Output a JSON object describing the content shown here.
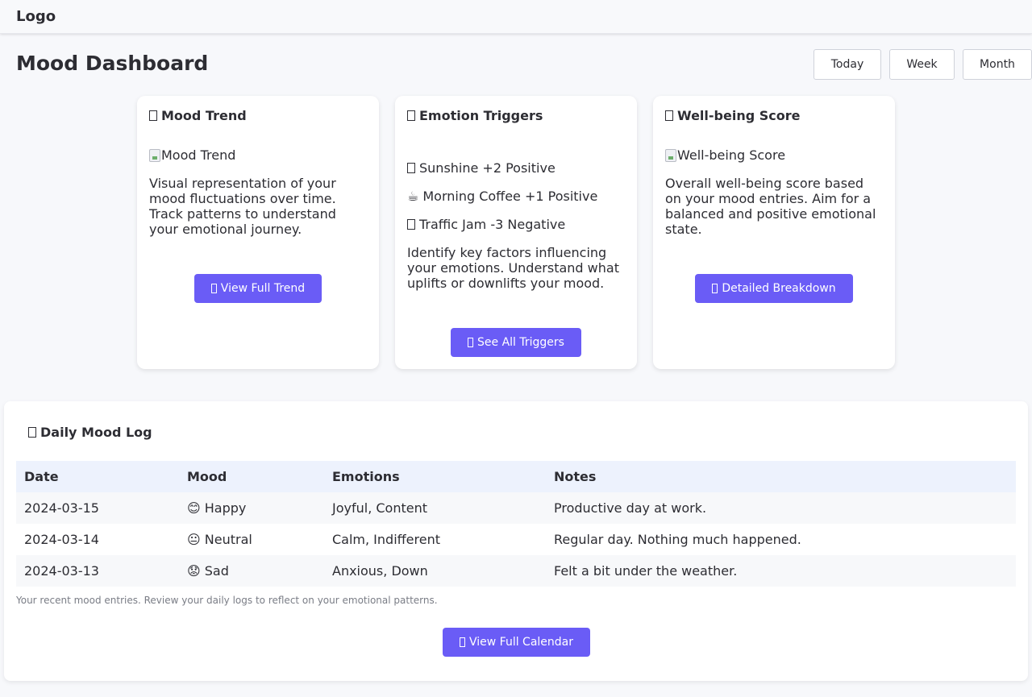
{
  "header": {
    "logo": "Logo"
  },
  "page": {
    "title": "Mood Dashboard"
  },
  "range_filters": [
    "Today",
    "Week",
    "Month"
  ],
  "cards": {
    "trend": {
      "title": "Mood Trend",
      "image_alt": "Mood Trend",
      "description": "Visual representation of your mood fluctuations over time. Track patterns to understand your emotional journey.",
      "button": "View Full Trend"
    },
    "triggers": {
      "title": "Emotion Triggers",
      "items": [
        {
          "icon": "sun-icon",
          "glyph": "",
          "text": "Sunshine +2 Positive"
        },
        {
          "icon": "coffee-icon",
          "glyph": "☕",
          "text": "Morning Coffee +1 Positive"
        },
        {
          "icon": "car-icon",
          "glyph": "",
          "text": "Traffic Jam -3 Negative"
        }
      ],
      "description": "Identify key factors influencing your emotions. Understand what uplifts or downlifts your mood.",
      "button": "See All Triggers"
    },
    "wellbeing": {
      "title": "Well-being Score",
      "image_alt": "Well-being Score",
      "description": "Overall well-being score based on your mood entries. Aim for a balanced and positive emotional state.",
      "button": "Detailed Breakdown"
    }
  },
  "mood_log": {
    "title": "Daily Mood Log",
    "columns": [
      "Date",
      "Mood",
      "Emotions",
      "Notes"
    ],
    "rows": [
      {
        "date": "2024-03-15",
        "mood": "😊 Happy",
        "emotions": "Joyful, Content",
        "notes": "Productive day at work."
      },
      {
        "date": "2024-03-14",
        "mood": "😐 Neutral",
        "emotions": "Calm, Indifferent",
        "notes": "Regular day. Nothing much happened."
      },
      {
        "date": "2024-03-13",
        "mood": "😟 Sad",
        "emotions": "Anxious, Down",
        "notes": "Felt a bit under the weather."
      }
    ],
    "caption": "Your recent mood entries. Review your daily logs to reflect on your emotional patterns.",
    "button": "View Full Calendar"
  },
  "colors": {
    "accent": "#6a5cf6",
    "background": "#f7f8fb",
    "table_header": "#edf2fd",
    "text": "#2d2d33"
  }
}
